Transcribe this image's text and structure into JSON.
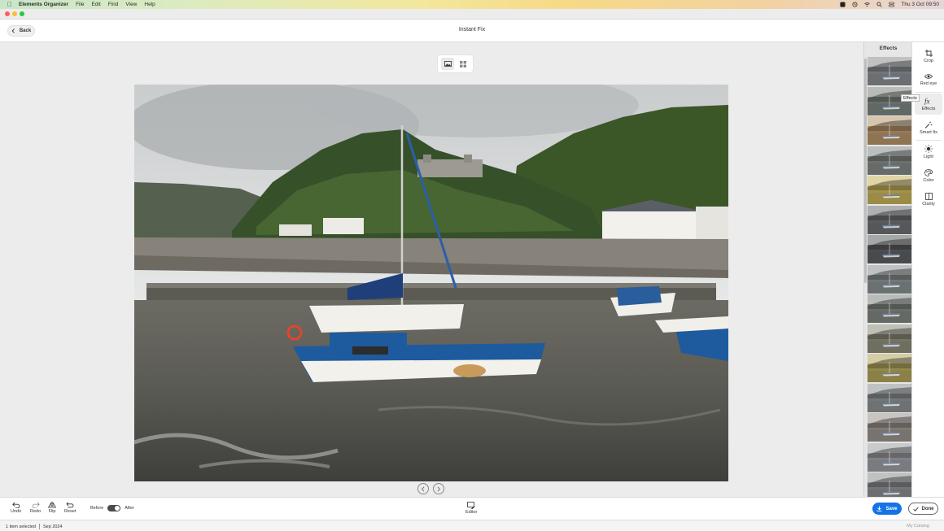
{
  "menubar": {
    "app_name": "Elements Organizer",
    "items": [
      "File",
      "Edit",
      "Find",
      "View",
      "Help"
    ],
    "clock": "Thu 3 Oct  09:50"
  },
  "header": {
    "back_label": "Back",
    "title": "Instant Fix"
  },
  "effects_panel": {
    "title": "Effects",
    "thumbnail_count": 15,
    "thumb_tints": [
      "#8a8f92",
      "#7e8680",
      "#b8956a",
      "#848a86",
      "#c7b25a",
      "#6e7072",
      "#5d5f61",
      "#8a9090",
      "#808782",
      "#8f8d7a",
      "#b2a65c",
      "#8d9292",
      "#9b9490",
      "#9b9ea2",
      "#8c8e8f"
    ]
  },
  "tools": {
    "crop": "Crop",
    "red_eye": "Red eye",
    "effects": "Effects",
    "smart_fix": "Smart fix",
    "light": "Light",
    "color": "Color",
    "clarity": "Clarity",
    "tooltip": "Effects"
  },
  "bottom": {
    "undo": "Undo",
    "redo": "Redo",
    "flip": "Flip",
    "reset": "Reset",
    "before": "Before",
    "after": "After",
    "editor": "Editor",
    "save": "Save",
    "done": "Done"
  },
  "status": {
    "selection": "1 item selected",
    "date": "Sep 2024",
    "catalog": "My Catalog"
  },
  "colors": {
    "accent": "#1473e6",
    "boat_blue": "#1e5a9e",
    "hill_green": "#3d5a2a"
  }
}
